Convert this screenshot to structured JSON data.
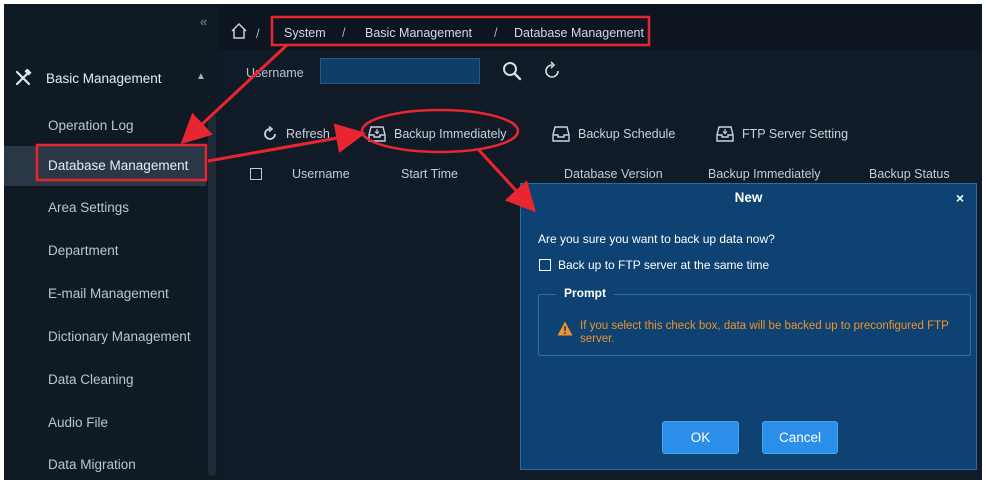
{
  "sidebar": {
    "collapse_glyph": "«",
    "group": {
      "label": "Basic Management",
      "icon": "tools-icon",
      "chevron": "^"
    },
    "items": [
      {
        "label": "Operation Log",
        "active": false
      },
      {
        "label": "Database Management",
        "active": true
      },
      {
        "label": "Area Settings",
        "active": false
      },
      {
        "label": "Department",
        "active": false
      },
      {
        "label": "E-mail Management",
        "active": false
      },
      {
        "label": "Dictionary Management",
        "active": false
      },
      {
        "label": "Data Cleaning",
        "active": false
      },
      {
        "label": "Audio File",
        "active": false
      },
      {
        "label": "Data Migration",
        "active": false
      }
    ]
  },
  "breadcrumb": {
    "separator": "/",
    "items": [
      "System",
      "Basic Management",
      "Database Management"
    ]
  },
  "filter": {
    "username_label": "Username",
    "username_value": ""
  },
  "toolbar": {
    "refresh": "Refresh",
    "backup_immediately": "Backup Immediately",
    "backup_schedule": "Backup Schedule",
    "ftp_setting": "FTP Server Setting"
  },
  "table": {
    "columns": [
      "Username",
      "Start Time",
      "Database Version",
      "Backup Immediately",
      "Backup Status"
    ]
  },
  "dialog": {
    "title": "New",
    "close": "×",
    "message": "Are you sure you want to back up data now?",
    "checkbox_label": "Back up to FTP server at the same time",
    "prompt_title": "Prompt",
    "prompt_text": "If you select this check box, data will be backed up to preconfigured FTP server.",
    "ok": "OK",
    "cancel": "Cancel"
  },
  "colors": {
    "annotation_red": "#e8262f",
    "accent_blue": "#2b8ee8",
    "warning_orange": "#f0932b"
  }
}
